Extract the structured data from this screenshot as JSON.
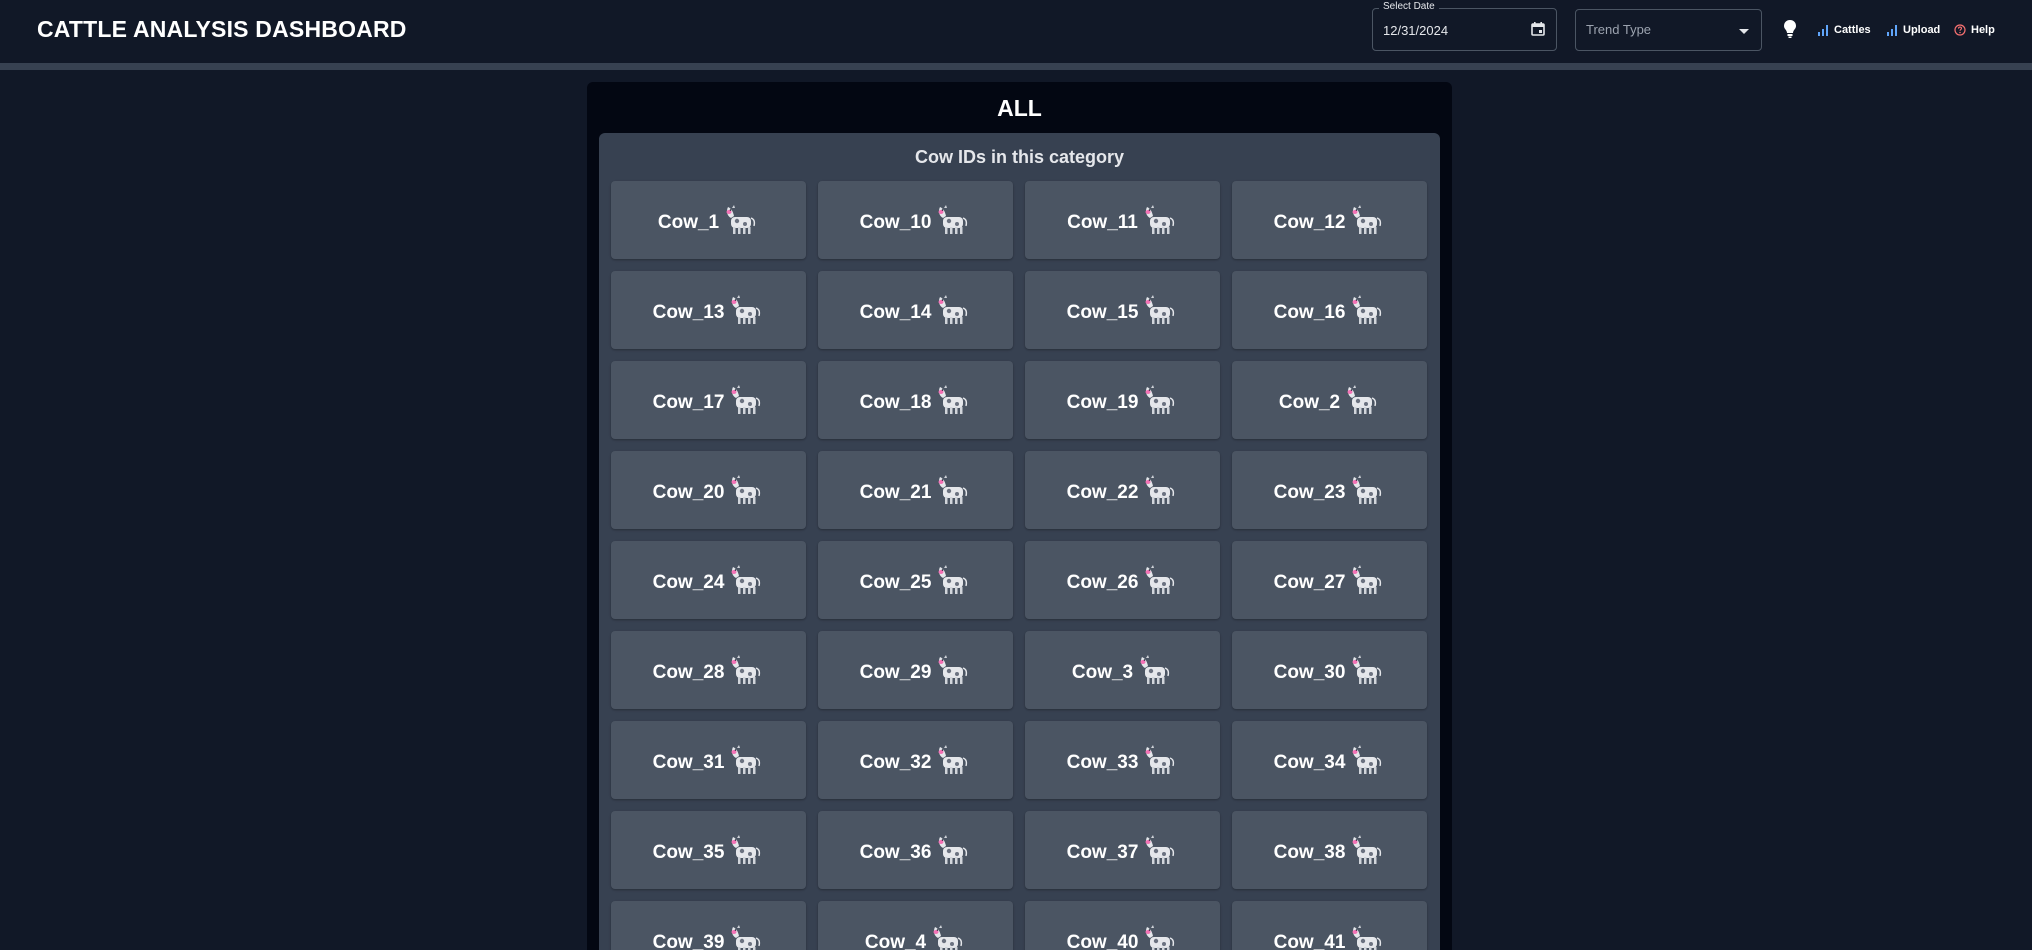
{
  "header": {
    "title": "CATTLE ANALYSIS DASHBOARD",
    "date_label": "Select Date",
    "date_value": "12/31/2024",
    "trend_placeholder": "Trend Type",
    "nav": {
      "cattles": "Cattles",
      "upload": "Upload",
      "help": "Help"
    }
  },
  "panel": {
    "title": "ALL",
    "subtitle": "Cow IDs in this category",
    "cows": [
      "Cow_1",
      "Cow_10",
      "Cow_11",
      "Cow_12",
      "Cow_13",
      "Cow_14",
      "Cow_15",
      "Cow_16",
      "Cow_17",
      "Cow_18",
      "Cow_19",
      "Cow_2",
      "Cow_20",
      "Cow_21",
      "Cow_22",
      "Cow_23",
      "Cow_24",
      "Cow_25",
      "Cow_26",
      "Cow_27",
      "Cow_28",
      "Cow_29",
      "Cow_3",
      "Cow_30",
      "Cow_31",
      "Cow_32",
      "Cow_33",
      "Cow_34",
      "Cow_35",
      "Cow_36",
      "Cow_37",
      "Cow_38",
      "Cow_39",
      "Cow_4",
      "Cow_40",
      "Cow_41"
    ]
  },
  "icons": {
    "cow": "cow-icon",
    "calendar": "calendar-icon",
    "bulb": "lightbulb-icon",
    "chart": "bar-chart-icon",
    "help": "help-circle-icon"
  },
  "colors": {
    "background": "#111827",
    "panel": "#030712",
    "card": "#374151",
    "tile": "#4b5563",
    "accent_blue": "#60a5fa",
    "help_red": "#f87171"
  }
}
